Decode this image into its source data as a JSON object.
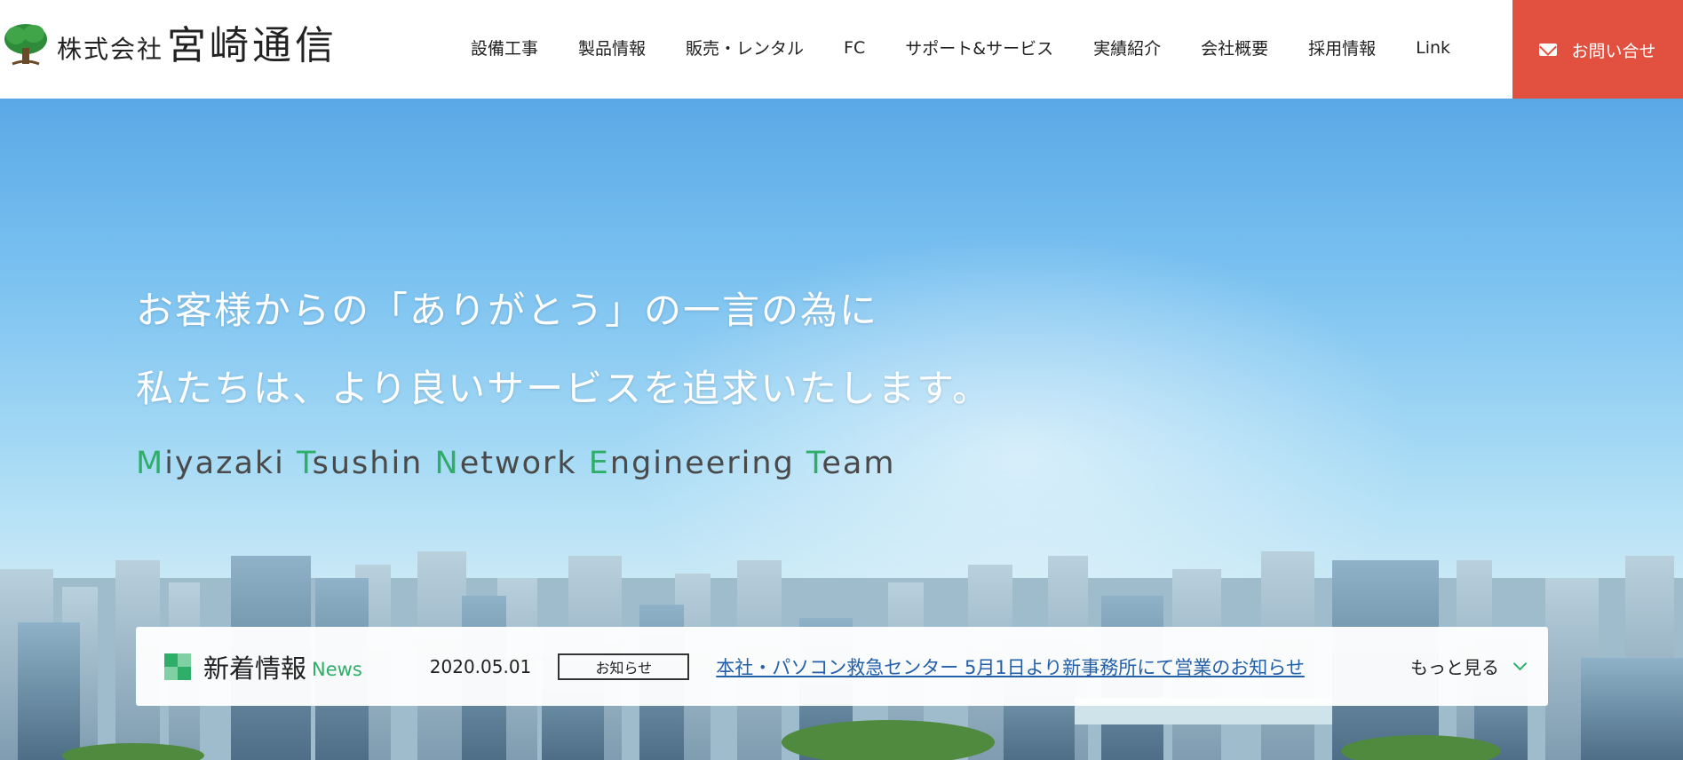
{
  "header": {
    "logo": {
      "small": "株式会社",
      "big": "宮崎通信"
    },
    "nav": [
      "設備工事",
      "製品情報",
      "販売・レンタル",
      "FC",
      "サポート&サービス",
      "実績紹介",
      "会社概要",
      "採用情報",
      "Link"
    ],
    "contact_label": "お問い合せ",
    "contact_icon": "mail-icon"
  },
  "hero": {
    "headline_1": "お客様からの「ありがとう」の一言の為に",
    "headline_2": "私たちは、より良いサービスを追求いたします。",
    "tagline": [
      {
        "initial": "M",
        "rest": "iyazaki "
      },
      {
        "initial": "T",
        "rest": "sushin "
      },
      {
        "initial": "N",
        "rest": "etwork "
      },
      {
        "initial": "E",
        "rest": "ngineering "
      },
      {
        "initial": "T",
        "rest": "eam"
      }
    ]
  },
  "news": {
    "title": "新着情報",
    "subtitle": "News",
    "date": "2020.05.01",
    "badge": "お知らせ",
    "link": "本社・パソコン救急センター 5月1日より新事務所にて営業のお知らせ",
    "more": "もっと見る"
  },
  "colors": {
    "accent": "#2fae6a",
    "contact": "#e2503f",
    "link": "#2460a8"
  }
}
